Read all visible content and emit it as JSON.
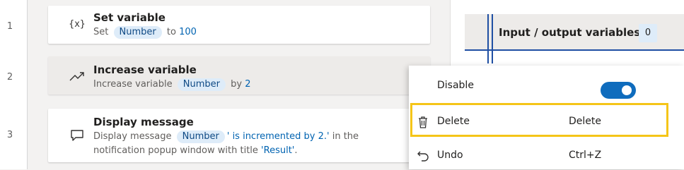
{
  "line_numbers": [
    "1",
    "2",
    "3"
  ],
  "actions": [
    {
      "icon": "variable-braces-icon",
      "icon_text": "{x}",
      "title": "Set variable",
      "desc": {
        "prefix": "Set",
        "token": "Number",
        "mid": "to",
        "value": "100"
      }
    },
    {
      "icon": "trending-up-icon",
      "title": "Increase variable",
      "desc": {
        "prefix": "Increase variable",
        "token": "Number",
        "mid": "by",
        "value": "2"
      }
    },
    {
      "icon": "message-icon",
      "title": "Display message",
      "desc": {
        "prefix": "Display message",
        "token": "Number",
        "value": "' is incremented by 2.'",
        "suffix": "in the",
        "line2_prefix": "notification popup window with title",
        "line2_value": "'Result'",
        "line2_suffix": "."
      }
    }
  ],
  "variables_panel": {
    "title": "Input / output variables",
    "count": "0"
  },
  "context_menu": {
    "items": [
      {
        "label": "Disable",
        "toggle_on": true
      },
      {
        "label": "Delete",
        "shortcut": "Delete",
        "icon": "trash-icon"
      },
      {
        "label": "Undo",
        "shortcut": "Ctrl+Z",
        "icon": "undo-icon"
      }
    ]
  },
  "colors": {
    "accent": "#0f6cbd",
    "token_bg": "#deecf9",
    "link": "#0063b1",
    "highlight": "#f5c518"
  }
}
